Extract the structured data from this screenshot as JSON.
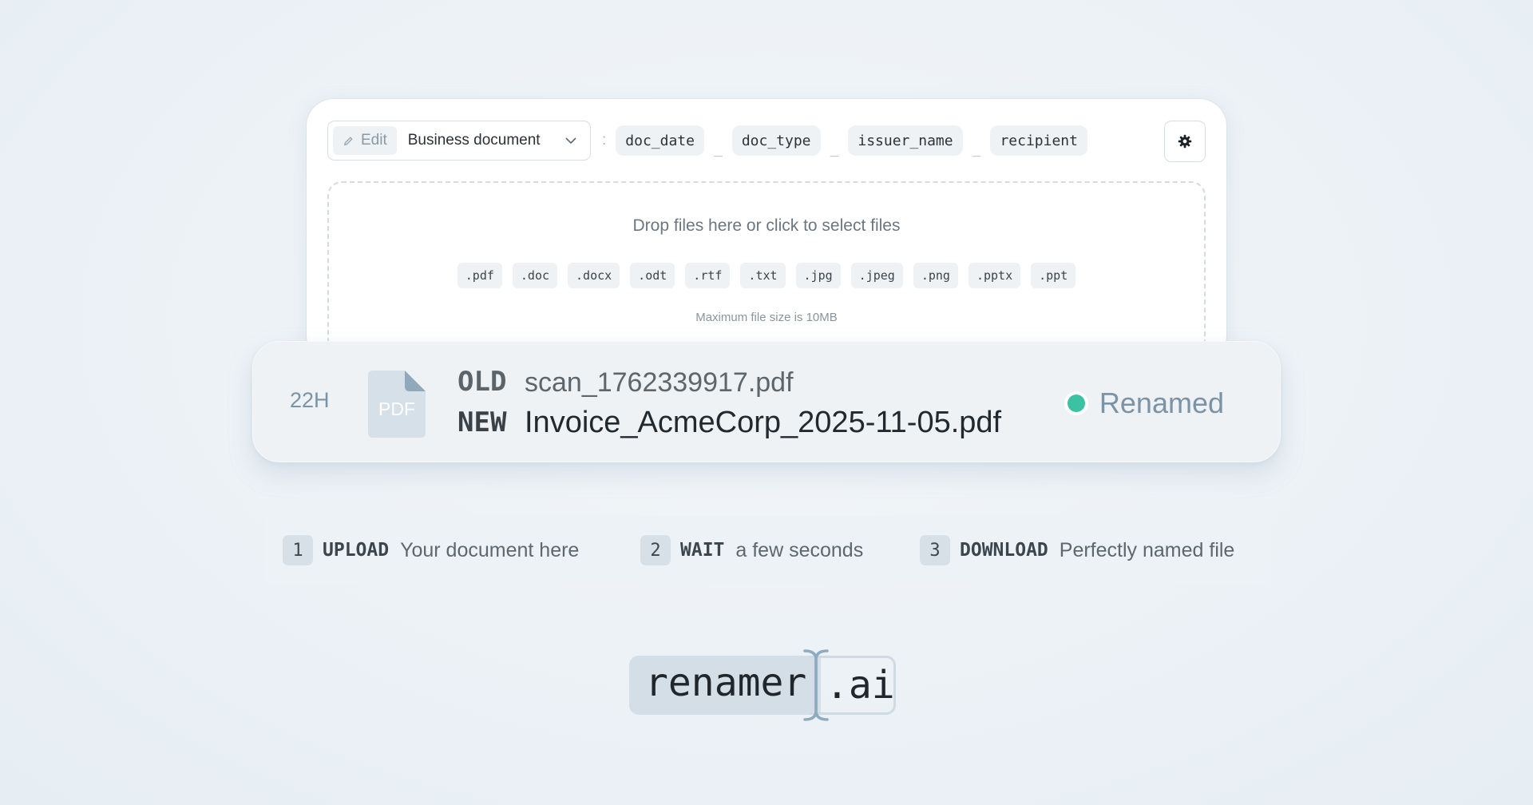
{
  "toolbar": {
    "edit_label": "Edit",
    "template_name": "Business document",
    "separator_colon": ":",
    "tokens": [
      "doc_date",
      "doc_type",
      "issuer_name",
      "recipient"
    ],
    "token_separator": "_"
  },
  "dropzone": {
    "title": "Drop files here or click to select files",
    "extensions": [
      ".pdf",
      ".doc",
      ".docx",
      ".odt",
      ".rtf",
      ".txt",
      ".jpg",
      ".jpeg",
      ".png",
      ".pptx",
      ".ppt"
    ],
    "max_size": "Maximum file size is 10MB"
  },
  "result": {
    "age": "22H",
    "file_type": "PDF",
    "old_label": "OLD",
    "old_name": "scan_1762339917.pdf",
    "new_label": "NEW",
    "new_name": "Invoice_AcmeCorp_2025-11-05.pdf",
    "status": "Renamed",
    "status_color": "#3ac2a3"
  },
  "steps": [
    {
      "num": "1",
      "key": "UPLOAD",
      "desc": "Your document here"
    },
    {
      "num": "2",
      "key": "WAIT",
      "desc": "a few seconds"
    },
    {
      "num": "3",
      "key": "DOWNLOAD",
      "desc": "Perfectly named file"
    }
  ],
  "logo": {
    "main": "renamer",
    "ext": ".ai"
  }
}
